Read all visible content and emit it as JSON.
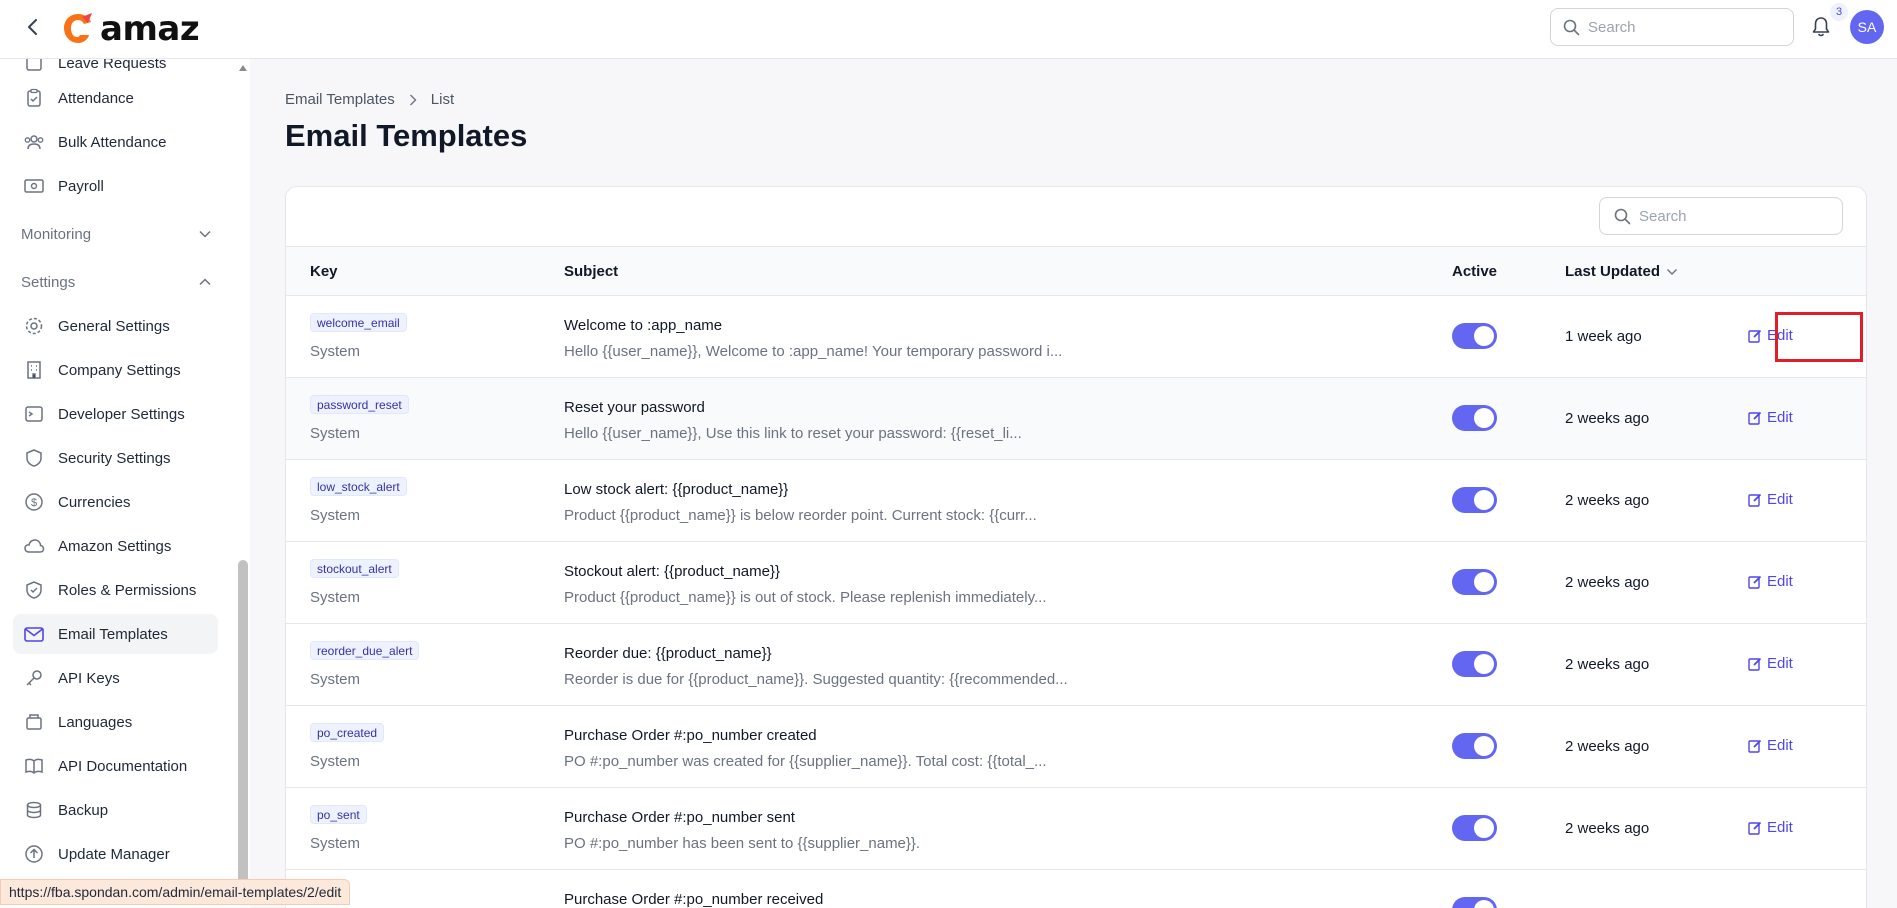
{
  "topbar": {
    "logo_text": "amaz",
    "search_placeholder": "Search",
    "notification_count": "3",
    "avatar_initials": "SA"
  },
  "sidebar": {
    "partial_top_label": "Leave Requests",
    "items_top": [
      {
        "label": "Attendance",
        "icon": "clipboard-icon"
      },
      {
        "label": "Bulk Attendance",
        "icon": "users-icon"
      },
      {
        "label": "Payroll",
        "icon": "money-icon"
      }
    ],
    "group_monitoring": "Monitoring",
    "group_settings": "Settings",
    "settings_items": [
      {
        "label": "General Settings",
        "icon": "gear-icon"
      },
      {
        "label": "Company Settings",
        "icon": "building-icon"
      },
      {
        "label": "Developer Settings",
        "icon": "terminal-icon"
      },
      {
        "label": "Security Settings",
        "icon": "shield-icon"
      },
      {
        "label": "Currencies",
        "icon": "dollar-icon"
      },
      {
        "label": "Amazon Settings",
        "icon": "cloud-icon"
      },
      {
        "label": "Roles & Permissions",
        "icon": "shield-check-icon"
      },
      {
        "label": "Email Templates",
        "icon": "envelope-icon",
        "active": true
      },
      {
        "label": "API Keys",
        "icon": "key-icon"
      },
      {
        "label": "Languages",
        "icon": "language-icon"
      },
      {
        "label": "API Documentation",
        "icon": "book-icon"
      },
      {
        "label": "Backup",
        "icon": "database-icon"
      },
      {
        "label": "Update Manager",
        "icon": "arrow-up-circle-icon"
      }
    ]
  },
  "main": {
    "breadcrumb": [
      "Email Templates",
      "List"
    ],
    "title": "Email Templates",
    "search_placeholder": "Search",
    "columns": {
      "key": "Key",
      "subject": "Subject",
      "active": "Active",
      "last_updated": "Last Updated"
    },
    "rows": [
      {
        "key": "welcome_email",
        "type": "System",
        "subject": "Welcome to :app_name",
        "body": "Hello {{user_name}}, Welcome to :app_name! Your temporary password i...",
        "active": true,
        "updated": "1 week ago",
        "action": "Edit"
      },
      {
        "key": "password_reset",
        "type": "System",
        "subject": "Reset your password",
        "body": "Hello {{user_name}}, Use this link to reset your password: {{reset_li...",
        "active": true,
        "updated": "2 weeks ago",
        "action": "Edit"
      },
      {
        "key": "low_stock_alert",
        "type": "System",
        "subject": "Low stock alert: {{product_name}}",
        "body": "Product {{product_name}} is below reorder point. Current stock: {{curr...",
        "active": true,
        "updated": "2 weeks ago",
        "action": "Edit"
      },
      {
        "key": "stockout_alert",
        "type": "System",
        "subject": "Stockout alert: {{product_name}}",
        "body": "Product {{product_name}} is out of stock. Please replenish immediately...",
        "active": true,
        "updated": "2 weeks ago",
        "action": "Edit"
      },
      {
        "key": "reorder_due_alert",
        "type": "System",
        "subject": "Reorder due: {{product_name}}",
        "body": "Reorder is due for {{product_name}}. Suggested quantity: {{recommended...",
        "active": true,
        "updated": "2 weeks ago",
        "action": "Edit"
      },
      {
        "key": "po_created",
        "type": "System",
        "subject": "Purchase Order #:po_number created",
        "body": "PO #:po_number was created for {{supplier_name}}. Total cost: {{total_...",
        "active": true,
        "updated": "2 weeks ago",
        "action": "Edit"
      },
      {
        "key": "po_sent",
        "type": "System",
        "subject": "Purchase Order #:po_number sent",
        "body": "PO #:po_number has been sent to {{supplier_name}}.",
        "active": true,
        "updated": "2 weeks ago",
        "action": "Edit"
      },
      {
        "key": "",
        "type": "",
        "subject": "Purchase Order #:po_number received",
        "body": "",
        "active": true,
        "updated": "",
        "action": ""
      }
    ]
  },
  "status_url": "https://fba.spondan.com/admin/email-templates/2/edit",
  "colors": {
    "accent": "#6366f1",
    "highlight": "#e11d2a"
  }
}
